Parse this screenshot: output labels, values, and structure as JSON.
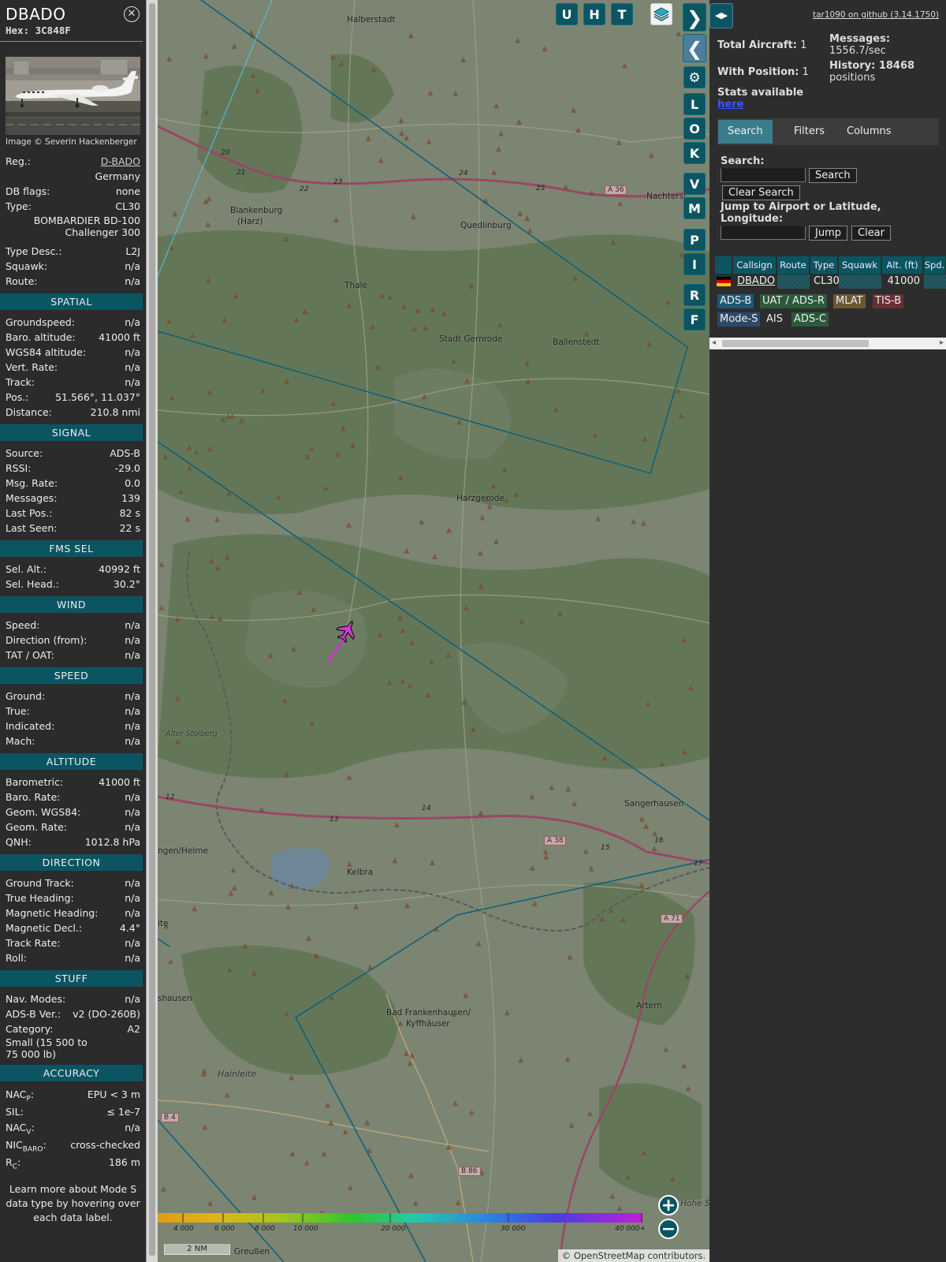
{
  "info": {
    "callsign": "DBADO",
    "hex": "Hex: 3C848F",
    "photo_credit": "Image © Severin Hackenberger",
    "details": {
      "reg_label": "Reg.:",
      "reg_value": "D-BADO",
      "country": "Germany",
      "dbflags_label": "DB flags:",
      "dbflags_value": "none",
      "type_label": "Type:",
      "type_value": "CL30",
      "type_name_1": "BOMBARDIER BD-100",
      "type_name_2": "Challenger 300",
      "typedesc_label": "Type Desc.:",
      "typedesc_value": "L2J",
      "squawk_label": "Squawk:",
      "squawk_value": "n/a",
      "route_label": "Route:",
      "route_value": "n/a"
    },
    "spatial": {
      "title": "SPATIAL",
      "rows": [
        {
          "k": "Groundspeed:",
          "v": "n/a"
        },
        {
          "k": "Baro. altitude:",
          "v": "41000 ft"
        },
        {
          "k": "WGS84 altitude:",
          "v": "n/a"
        },
        {
          "k": "Vert. Rate:",
          "v": "n/a"
        },
        {
          "k": "Track:",
          "v": "n/a"
        },
        {
          "k": "Pos.:",
          "v": "51.566°, 11.037°"
        },
        {
          "k": "Distance:",
          "v": "210.8 nmi"
        }
      ]
    },
    "signal": {
      "title": "SIGNAL",
      "rows": [
        {
          "k": "Source:",
          "v": "ADS-B"
        },
        {
          "k": "RSSI:",
          "v": "-29.0"
        },
        {
          "k": "Msg. Rate:",
          "v": "0.0"
        },
        {
          "k": "Messages:",
          "v": "139"
        },
        {
          "k": "Last Pos.:",
          "v": "82 s"
        },
        {
          "k": "Last Seen:",
          "v": "22 s"
        }
      ]
    },
    "fms": {
      "title": "FMS SEL",
      "rows": [
        {
          "k": "Sel. Alt.:",
          "v": "40992 ft"
        },
        {
          "k": "Sel. Head.:",
          "v": "30.2°"
        }
      ]
    },
    "wind": {
      "title": "WIND",
      "rows": [
        {
          "k": "Speed:",
          "v": "n/a"
        },
        {
          "k": "Direction (from):",
          "v": "n/a"
        },
        {
          "k": "TAT / OAT:",
          "v": "n/a"
        }
      ]
    },
    "speed": {
      "title": "SPEED",
      "rows": [
        {
          "k": "Ground:",
          "v": "n/a"
        },
        {
          "k": "True:",
          "v": "n/a"
        },
        {
          "k": "Indicated:",
          "v": "n/a"
        },
        {
          "k": "Mach:",
          "v": "n/a"
        }
      ]
    },
    "altitude": {
      "title": "ALTITUDE",
      "rows": [
        {
          "k": "Barometric:",
          "v": "41000 ft"
        },
        {
          "k": "Baro. Rate:",
          "v": "n/a"
        },
        {
          "k": "Geom. WGS84:",
          "v": "n/a"
        },
        {
          "k": "Geom. Rate:",
          "v": "n/a"
        },
        {
          "k": "QNH:",
          "v": "1012.8 hPa"
        }
      ]
    },
    "direction": {
      "title": "DIRECTION",
      "rows": [
        {
          "k": "Ground Track:",
          "v": "n/a"
        },
        {
          "k": "True Heading:",
          "v": "n/a"
        },
        {
          "k": "Magnetic Heading:",
          "v": "n/a"
        },
        {
          "k": "Magnetic Decl.:",
          "v": "4.4°"
        },
        {
          "k": "Track Rate:",
          "v": "n/a"
        },
        {
          "k": "Roll:",
          "v": "n/a"
        }
      ]
    },
    "stuff": {
      "title": "STUFF",
      "rows": [
        {
          "k": "Nav. Modes:",
          "v": "n/a"
        },
        {
          "k": "ADS-B Ver.:",
          "v": "v2 (DO-260B)"
        },
        {
          "k": "Category:",
          "v": "A2"
        }
      ],
      "category_desc_1": "Small (15 500 to",
      "category_desc_2": "75 000 lb)"
    },
    "accuracy": {
      "title": "ACCURACY",
      "nacp_k": "NAC",
      "nacp_sub": "P",
      "nacp_v": "EPU < 3 m",
      "sil_k": "SIL:",
      "sil_v": "≤ 1e-7",
      "nacv_k": "NAC",
      "nacv_sub": "V",
      "nacv_v": "n/a",
      "nic_k": "NIC",
      "nic_sub": "BARO",
      "nic_v": "cross-checked",
      "rc_k": "R",
      "rc_sub": "C",
      "rc_v": "186 m"
    },
    "footer_1": "Learn more about Mode S",
    "footer_2": "data type by hovering over",
    "footer_3": "each data label."
  },
  "map": {
    "buttons": [
      "U",
      "H",
      "T",
      "L",
      "O",
      "K",
      "V",
      "M",
      "P",
      "I",
      "R",
      "F"
    ],
    "places": {
      "halberstadt": "Halberstadt",
      "blankenburg_1": "Blankenburg",
      "blankenburg_2": "(Harz)",
      "quedlinburg": "Quedlinburg",
      "nachterstedt": "Nachterst",
      "thale": "Thale",
      "stadt_gernrode": "Stadt Gernrode",
      "ballenstedt": "Ballenstedt",
      "harzgerode": "Harzgerode",
      "alter_stolberg": "Alter Stolberg",
      "sangerhausen": "Sangerhausen",
      "nordhausen": "ngen/Helme",
      "kelbra": "Kelbra",
      "ite": "ite",
      "shausen": "shausen",
      "bad_frankenhausen_1": "Bad Frankenhausen/",
      "bad_frankenhausen_2": "Kyffhäuser",
      "artern": "Artern",
      "hainleite": "Hainleite",
      "hohe": "Hohe S",
      "greussen": "Greußen"
    },
    "roads": {
      "a36": "A 36",
      "a38": "A 38",
      "a71": "A 71",
      "b4": "B 4",
      "b86": "B 86"
    },
    "km_marks": [
      "20",
      "21",
      "22",
      "23",
      "24",
      "25",
      "12",
      "13",
      "14",
      "15",
      "16",
      "17"
    ],
    "altitude_scale": [
      "4 000",
      "6 000",
      "8 000",
      "10 000",
      "20 000",
      "30 000",
      "40 000+"
    ],
    "scale_bar": "2 NM",
    "attribution_prefix": "©",
    "attribution_link": "OpenStreetMap",
    "attribution_suffix": "contributors."
  },
  "sidebar": {
    "version": "tar1090 on github (3.14.1750)",
    "total_label": "Total Aircraft:",
    "total_value": "1",
    "withpos_label": "With Position:",
    "withpos_value": "1",
    "stats_label": "Stats available",
    "stats_link": "here",
    "messages_label": "Messages:",
    "messages_value": "1556.7/sec",
    "history_label": "History: 18468",
    "history_label_2": "positions",
    "tabs": [
      "Search",
      "Filters",
      "Columns"
    ],
    "search_label": "Search:",
    "search_value": "",
    "search_button": "Search",
    "clear_search_button": "Clear Search",
    "jump_label_1": "Jump to Airport or Latitude,",
    "jump_label_2": "Longitude:",
    "jump_value": "",
    "jump_button": "Jump",
    "clear_button": "Clear",
    "table": {
      "columns": [
        "Callsign",
        "Route",
        "Type",
        "Squawk",
        "Alt. (ft)",
        "Spd."
      ],
      "rows": [
        {
          "flag": "germany",
          "callsign": "DBADO",
          "route": "",
          "type": "CL30",
          "squawk": "",
          "alt": "41000"
        }
      ]
    },
    "sources": [
      {
        "label": "ADS-B",
        "color": "#1e5874"
      },
      {
        "label": "UAT / ADS-R",
        "color": "#2b5a3a"
      },
      {
        "label": "MLAT",
        "color": "#6b5832"
      },
      {
        "label": "TIS-B",
        "color": "#6b2e35"
      },
      {
        "label": "Mode-S",
        "color": "#2c4a68"
      },
      {
        "label": "AIS",
        "color": "#2d2d2d"
      },
      {
        "label": "ADS-C",
        "color": "#2b5a3a"
      }
    ]
  }
}
